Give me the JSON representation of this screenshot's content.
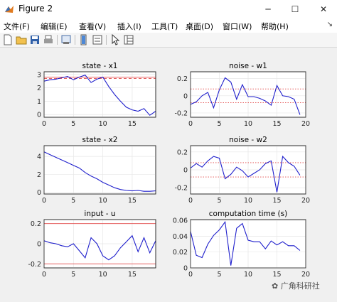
{
  "window": {
    "title": "Figure 2"
  },
  "titlebar": {
    "minimize": "─",
    "maximize": "☐",
    "close": "✕"
  },
  "menu": {
    "items": [
      "文件(F)",
      "编辑(E)",
      "查看(V)",
      "插入(I)",
      "工具(T)",
      "桌面(D)",
      "窗口(W)",
      "帮助(H)"
    ]
  },
  "toolbar": {
    "icons": [
      "new-figure-icon",
      "open-file-icon",
      "save-icon",
      "print-icon",
      "print-preview-icon",
      "colorbar-icon",
      "legend-icon",
      "pointer-icon",
      "property-inspector-icon"
    ]
  },
  "colors": {
    "line": "#1f1fcc",
    "limit": "#e24a4a",
    "grid": "#e6e6e6"
  },
  "watermark": "广角科研社",
  "chart_data": [
    {
      "type": "line",
      "title": "state - x1",
      "xlim": [
        0,
        19
      ],
      "ylim": [
        -0.2,
        3.2
      ],
      "xticks": [
        0,
        5,
        10,
        15
      ],
      "yticks": [
        0,
        1,
        2,
        3
      ],
      "hlines": [
        {
          "y": 2.8,
          "style": "solid"
        },
        {
          "y": 2.7,
          "style": "dashed"
        }
      ],
      "x": [
        0,
        1,
        2,
        3,
        4,
        5,
        6,
        7,
        8,
        9,
        10,
        11,
        12,
        13,
        14,
        15,
        16,
        17,
        18,
        19
      ],
      "y": [
        2.5,
        2.6,
        2.65,
        2.75,
        2.85,
        2.6,
        2.8,
        2.95,
        2.4,
        2.65,
        2.8,
        2.1,
        1.5,
        1.0,
        0.55,
        0.35,
        0.25,
        0.45,
        -0.05,
        0.25
      ]
    },
    {
      "type": "line",
      "title": "noise - w1",
      "xlim": [
        0,
        20
      ],
      "ylim": [
        -0.25,
        0.28
      ],
      "xticks": [
        0,
        5,
        10,
        15,
        20
      ],
      "yticks": [
        -0.2,
        0,
        0.2
      ],
      "ytickLabels": [
        "-0.2",
        "0",
        "0.2"
      ],
      "hlines": [
        {
          "y": 0.08,
          "style": "dotted"
        },
        {
          "y": -0.08,
          "style": "dotted"
        }
      ],
      "x": [
        0,
        1,
        2,
        3,
        4,
        5,
        6,
        7,
        8,
        9,
        10,
        11,
        12,
        13,
        14,
        15,
        16,
        17,
        18,
        19
      ],
      "y": [
        -0.1,
        -0.07,
        0.0,
        0.04,
        -0.14,
        0.07,
        0.21,
        0.16,
        -0.04,
        0.13,
        -0.01,
        -0.01,
        -0.03,
        -0.06,
        -0.11,
        0.12,
        0.0,
        -0.01,
        -0.04,
        -0.22
      ]
    },
    {
      "type": "line",
      "title": "state - x2",
      "xlim": [
        0,
        19
      ],
      "ylim": [
        -0.2,
        5.2
      ],
      "xticks": [
        0,
        5,
        10,
        15
      ],
      "yticks": [
        0,
        2,
        4
      ],
      "x": [
        0,
        1,
        2,
        3,
        4,
        5,
        6,
        7,
        8,
        9,
        10,
        11,
        12,
        13,
        14,
        15,
        16,
        17,
        18,
        19
      ],
      "y": [
        4.5,
        4.2,
        3.9,
        3.6,
        3.3,
        3.0,
        2.7,
        2.2,
        1.8,
        1.5,
        1.1,
        0.8,
        0.5,
        0.3,
        0.2,
        0.15,
        0.2,
        0.1,
        0.1,
        0.15
      ]
    },
    {
      "type": "line",
      "title": "noise - w2",
      "xlim": [
        0,
        20
      ],
      "ylim": [
        -0.27,
        0.27
      ],
      "xticks": [
        0,
        5,
        10,
        15,
        20
      ],
      "yticks": [
        -0.2,
        0,
        0.2
      ],
      "ytickLabels": [
        "-0.2",
        "0",
        "0.2"
      ],
      "hlines": [
        {
          "y": 0.08,
          "style": "dotted"
        },
        {
          "y": -0.08,
          "style": "dotted"
        }
      ],
      "x": [
        0,
        1,
        2,
        3,
        4,
        5,
        6,
        7,
        8,
        9,
        10,
        11,
        12,
        13,
        14,
        15,
        16,
        17,
        18,
        19
      ],
      "y": [
        0.02,
        0.07,
        0.03,
        0.1,
        0.15,
        0.13,
        -0.1,
        -0.05,
        0.03,
        -0.01,
        -0.08,
        -0.04,
        0.0,
        0.07,
        0.1,
        -0.25,
        0.15,
        0.08,
        0.04,
        -0.06
      ]
    },
    {
      "type": "line",
      "title": "input - u",
      "xlim": [
        0,
        19
      ],
      "ylim": [
        -0.24,
        0.24
      ],
      "xticks": [
        0,
        5,
        10,
        15
      ],
      "yticks": [
        -0.2,
        0,
        0.2
      ],
      "ytickLabels": [
        "-0.2",
        "0",
        "0.2"
      ],
      "hlines": [
        {
          "y": 0.2,
          "style": "solid"
        },
        {
          "y": -0.2,
          "style": "solid"
        }
      ],
      "x": [
        0,
        1,
        2,
        3,
        4,
        5,
        6,
        7,
        8,
        9,
        10,
        11,
        12,
        13,
        14,
        15,
        16,
        17,
        18,
        19
      ],
      "y": [
        0.03,
        0.01,
        0.0,
        -0.02,
        -0.03,
        0.0,
        -0.07,
        -0.14,
        0.06,
        0.0,
        -0.12,
        -0.16,
        -0.12,
        -0.04,
        0.02,
        0.08,
        -0.08,
        0.06,
        -0.09,
        0.03
      ]
    },
    {
      "type": "line",
      "title": "computation time (s)",
      "xlim": [
        0,
        20
      ],
      "ylim": [
        0,
        0.061
      ],
      "xticks": [
        0,
        5,
        10,
        15,
        20
      ],
      "yticks": [
        0,
        0.02,
        0.04,
        0.06
      ],
      "ytickLabels": [
        "0",
        "0.02",
        "0.04",
        "0.06"
      ],
      "x": [
        0,
        1,
        2,
        3,
        4,
        5,
        6,
        7,
        8,
        9,
        10,
        11,
        12,
        13,
        14,
        15,
        16,
        17,
        18,
        19
      ],
      "y": [
        0.046,
        0.016,
        0.013,
        0.03,
        0.041,
        0.048,
        0.058,
        0.003,
        0.05,
        0.056,
        0.035,
        0.033,
        0.033,
        0.024,
        0.034,
        0.029,
        0.033,
        0.028,
        0.028,
        0.022
      ]
    }
  ]
}
